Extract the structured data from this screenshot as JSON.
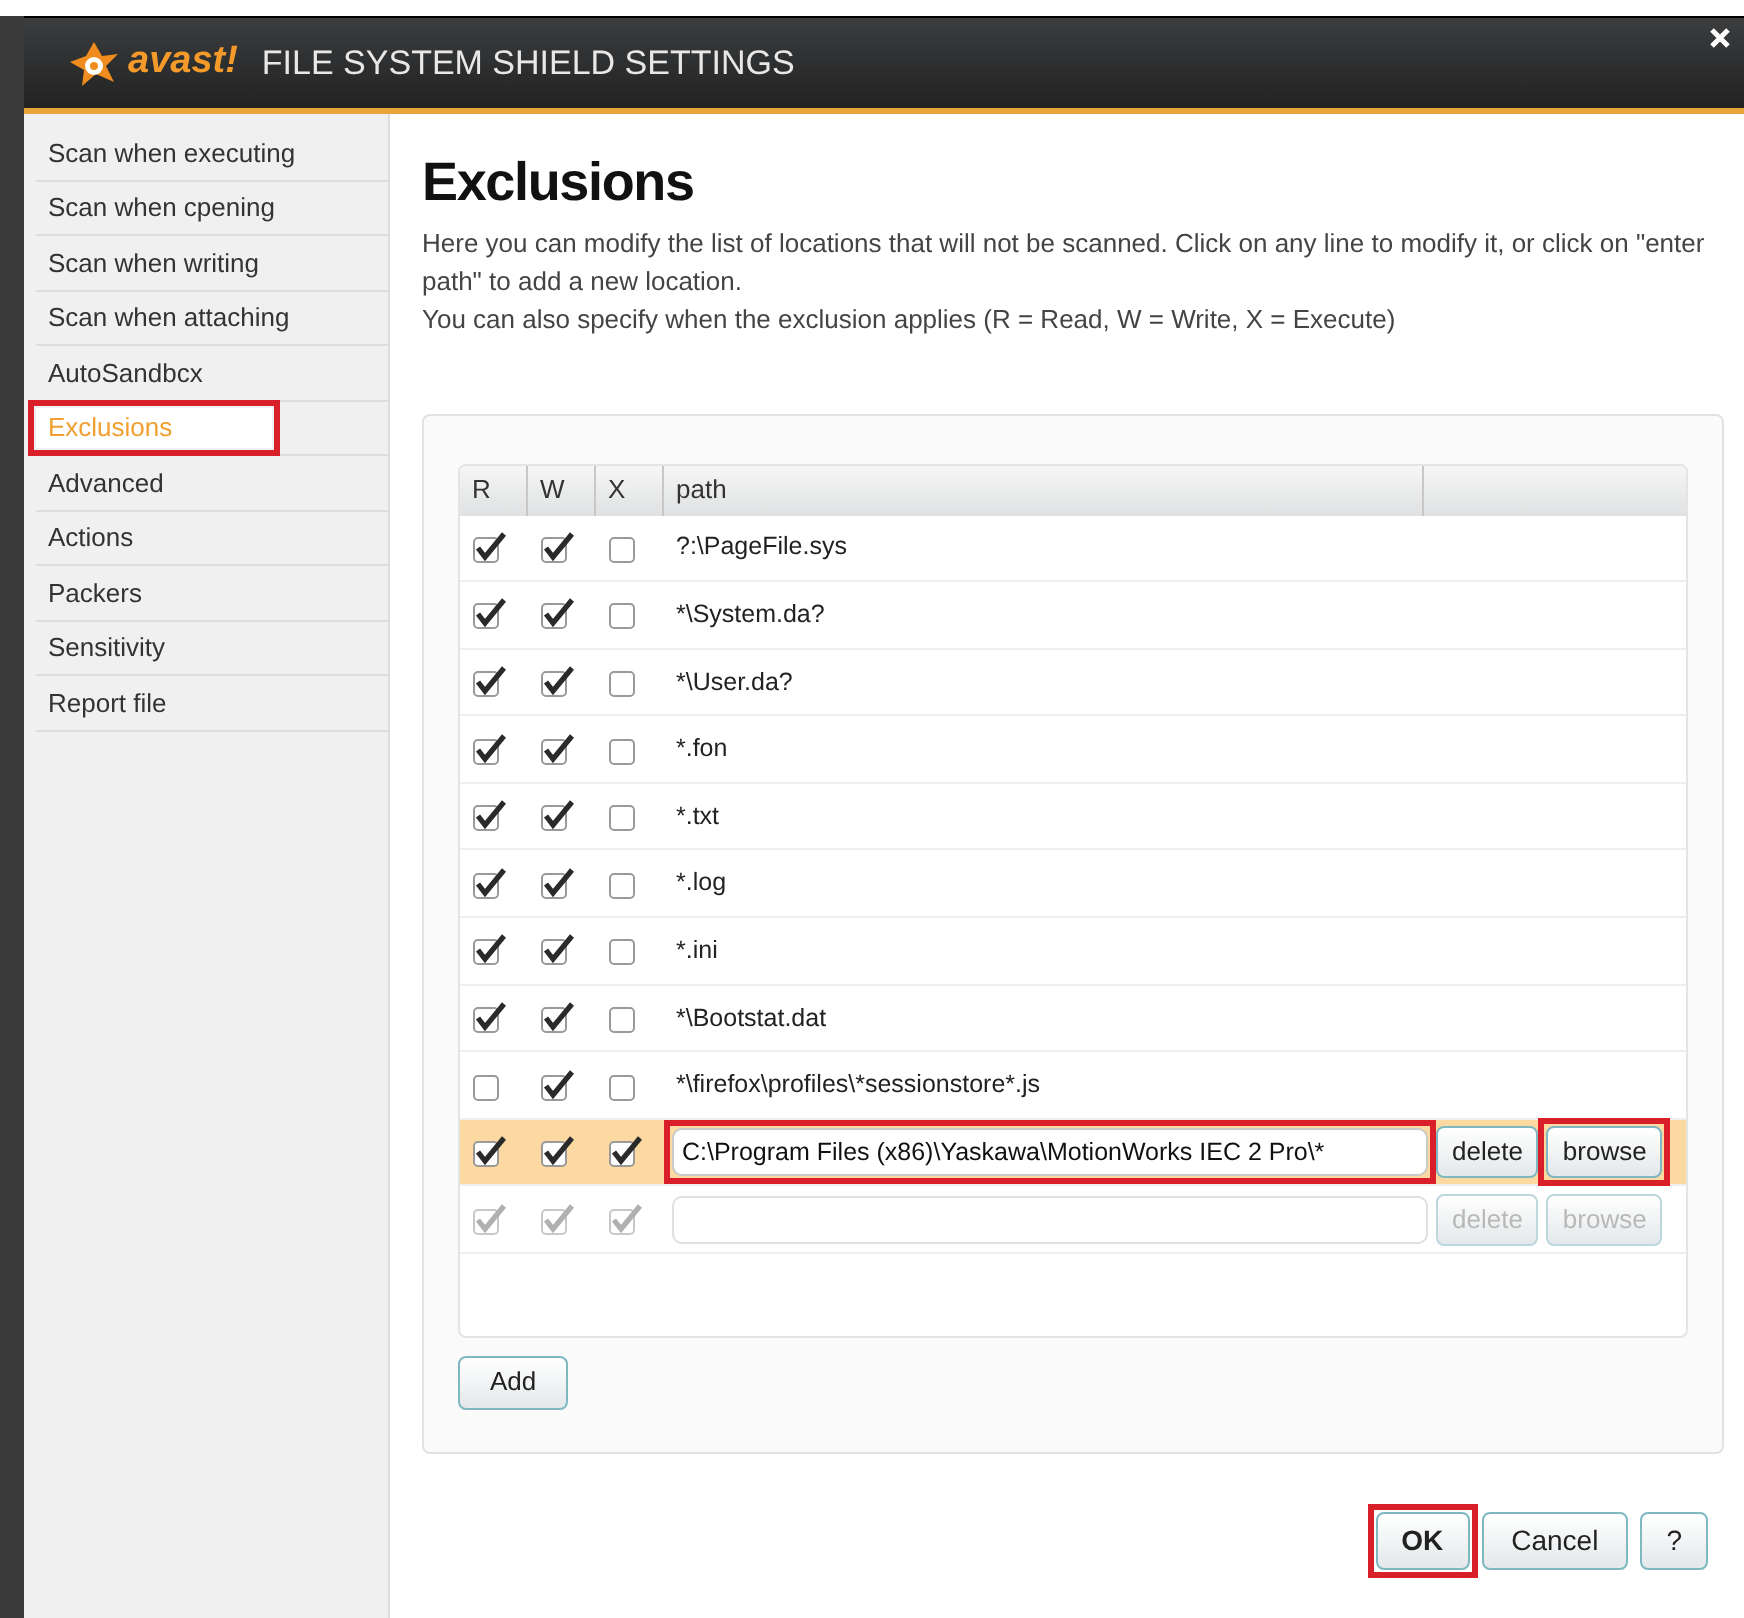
{
  "window": {
    "logo_text": "avast!",
    "title": "FILE SYSTEM SHIELD SETTINGS"
  },
  "sidebar": {
    "items": [
      {
        "label": "Scan when executing",
        "selected": false,
        "highlighted": false
      },
      {
        "label": "Scan when cpening",
        "selected": false,
        "highlighted": false
      },
      {
        "label": "Scan when writing",
        "selected": false,
        "highlighted": false
      },
      {
        "label": "Scan when attaching",
        "selected": false,
        "highlighted": false
      },
      {
        "label": "AutoSandbcx",
        "selected": false,
        "highlighted": false
      },
      {
        "label": "Exclusions",
        "selected": true,
        "highlighted": true
      },
      {
        "label": "Advanced",
        "selected": false,
        "highlighted": false
      },
      {
        "label": "Actions",
        "selected": false,
        "highlighted": false
      },
      {
        "label": "Packers",
        "selected": false,
        "highlighted": false
      },
      {
        "label": "Sensitivity",
        "selected": false,
        "highlighted": false
      },
      {
        "label": "Report file",
        "selected": false,
        "highlighted": false
      }
    ]
  },
  "heading": "Exclusions",
  "description": [
    "Here you can modify the list of locations that will not be scanned. Click on any line to modify it, or click on \"enter path\" to add a new location.",
    "You can also specify when the exclusion applies (R = Read, W = Write, X = Execute)"
  ],
  "table": {
    "columns": [
      "R",
      "W",
      "X",
      "path"
    ],
    "rows": [
      {
        "kind": "entry",
        "selected": false,
        "r": true,
        "w": true,
        "x": false,
        "path": "?:\\PageFile.sys"
      },
      {
        "kind": "entry",
        "selected": false,
        "r": true,
        "w": true,
        "x": false,
        "path": "*\\System.da?"
      },
      {
        "kind": "entry",
        "selected": false,
        "r": true,
        "w": true,
        "x": false,
        "path": "*\\User.da?"
      },
      {
        "kind": "entry",
        "selected": false,
        "r": true,
        "w": true,
        "x": false,
        "path": "*.fon"
      },
      {
        "kind": "entry",
        "selected": false,
        "r": true,
        "w": true,
        "x": false,
        "path": "*.txt"
      },
      {
        "kind": "entry",
        "selected": false,
        "r": true,
        "w": true,
        "x": false,
        "path": "*.log"
      },
      {
        "kind": "entry",
        "selected": false,
        "r": true,
        "w": true,
        "x": false,
        "path": "*.ini"
      },
      {
        "kind": "entry",
        "selected": false,
        "r": true,
        "w": true,
        "x": false,
        "path": "*\\Bootstat.dat"
      },
      {
        "kind": "entry",
        "selected": false,
        "r": false,
        "w": true,
        "x": false,
        "path": "*\\firefox\\profiles\\*sessionstore*.js"
      },
      {
        "kind": "editing",
        "selected": true,
        "r": true,
        "w": true,
        "x": true,
        "path": "C:\\Program Files (x86)\\Yaskawa\\MotionWorks IEC 2 Pro\\*",
        "path_highlighted": true,
        "delete": {
          "label": "delete",
          "highlighted": false
        },
        "browse": {
          "label": "browse",
          "highlighted": true
        }
      },
      {
        "kind": "new",
        "selected": false,
        "r": true,
        "w": true,
        "x": true,
        "path": "",
        "path_highlighted": false,
        "delete": {
          "label": "delete",
          "highlighted": false
        },
        "browse": {
          "label": "browse",
          "highlighted": false
        }
      }
    ]
  },
  "add_button": "Add",
  "footer_buttons": [
    {
      "label": "OK",
      "bold": true,
      "highlighted": true
    },
    {
      "label": "Cancel",
      "bold": false,
      "highlighted": false
    },
    {
      "label": "?",
      "bold": false,
      "highlighted": false
    }
  ]
}
